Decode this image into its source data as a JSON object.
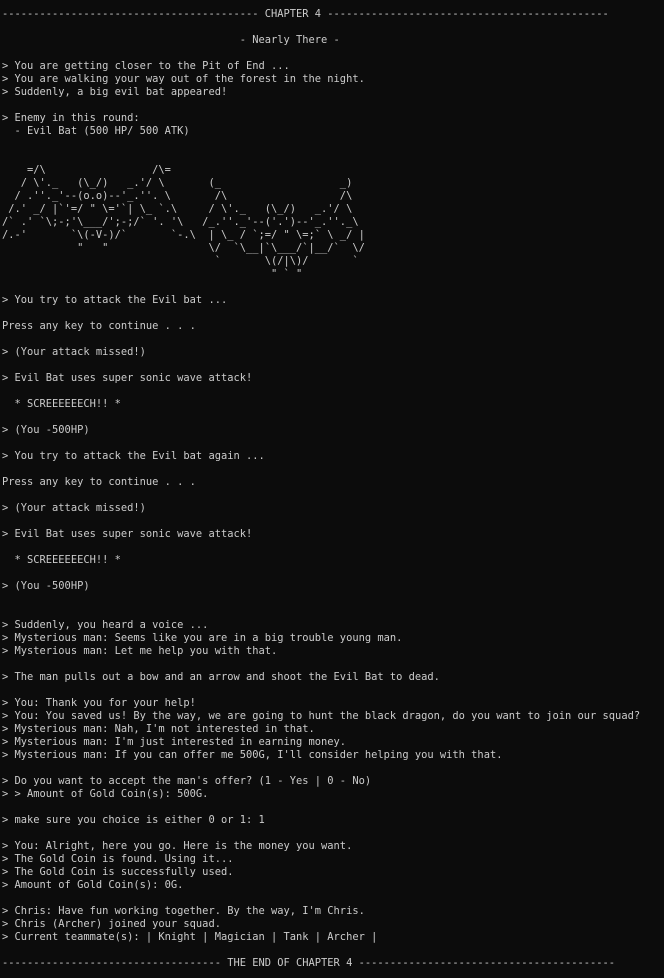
{
  "console": {
    "lines": [
      "----------------------------------------- CHAPTER 4 ---------------------------------------------",
      "",
      "                                      - Nearly There -",
      "",
      "> You are getting closer to the Pit of End ...",
      "> You are walking your way out of the forest in the night.",
      "> Suddenly, a big evil bat appeared!",
      "",
      "> Enemy in this round:",
      "  - Evil Bat (500 HP/ 500 ATK)",
      "",
      "",
      "    =/\\                 /\\=",
      "   / \\'._   (\\_/)   _.'/ \\       (_                   _)",
      "  / .''._'--(o.o)--'_.''. \\       /\\                  /\\",
      " /.' _/ |`'=/ \" \\='`| \\_ `.\\     / \\'._   (\\_/)   _.'/ \\",
      "/` .' `\\;-;'\\___/';-;/` '. '\\   /_.''._'--('.')--'_.''._\\",
      "/.-'       `\\(-V-)/`       `-.\\  | \\_ / `;=/ \" \\=;` \\ _/ |",
      "            \"   \"                \\/  `\\__|`\\___/`|__/`  \\/",
      "                                  `       \\(/|\\)/       `",
      "                                           \" ` \"",
      "",
      "> You try to attack the Evil bat ...",
      "",
      "Press any key to continue . . .",
      "",
      "> (Your attack missed!)",
      "",
      "> Evil Bat uses super sonic wave attack!",
      "",
      "  * SCREEEEEECH!! *",
      "",
      "> (You -500HP)",
      "",
      "> You try to attack the Evil bat again ...",
      "",
      "Press any key to continue . . .",
      "",
      "> (Your attack missed!)",
      "",
      "> Evil Bat uses super sonic wave attack!",
      "",
      "  * SCREEEEEECH!! *",
      "",
      "> (You -500HP)",
      "",
      "",
      "> Suddenly, you heard a voice ...",
      "> Mysterious man: Seems like you are in a big trouble young man.",
      "> Mysterious man: Let me help you with that.",
      "",
      "> The man pulls out a bow and an arrow and shoot the Evil Bat to dead.",
      "",
      "> You: Thank you for your help!",
      "> You: You saved us! By the way, we are going to hunt the black dragon, do you want to join our squad?",
      "> Mysterious man: Nah, I'm not interested in that.",
      "> Mysterious man: I'm just interested in earning money.",
      "> Mysterious man: If you can offer me 500G, I'll consider helping you with that.",
      "",
      "> Do you want to accept the man's offer? (1 - Yes | 0 - No)",
      "> > Amount of Gold Coin(s): 500G.",
      "",
      "> make sure you choice is either 0 or 1: 1",
      "",
      "> You: Alright, here you go. Here is the money you want.",
      "> The Gold Coin is found. Using it...",
      "> The Gold Coin is successfully used.",
      "> Amount of Gold Coin(s): 0G.",
      "",
      "> Chris: Have fun working together. By the way, I'm Chris.",
      "> Chris (Archer) joined your squad.",
      "> Current teammate(s): | Knight | Magician | Tank | Archer |",
      "",
      "----------------------------------- THE END OF CHAPTER 4 -----------------------------------------"
    ]
  }
}
